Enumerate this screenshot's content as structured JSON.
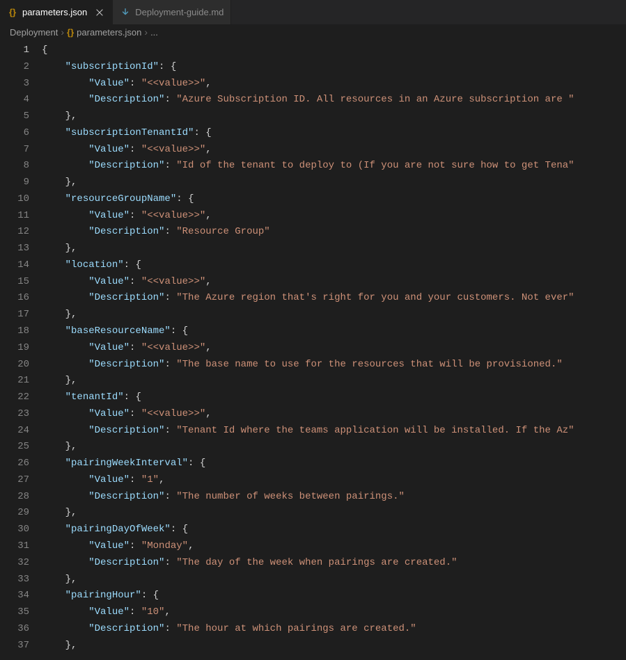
{
  "tabs": {
    "active": {
      "label": "parameters.json"
    },
    "inactive": {
      "label": "Deployment-guide.md"
    }
  },
  "breadcrumbs": {
    "item0": "Deployment",
    "item1": "parameters.json",
    "item2": "..."
  },
  "code": {
    "open": "{",
    "entries": [
      {
        "key": "subscriptionId",
        "value": "<<value>>",
        "desc": "Azure Subscription ID. All resources in an Azure subscription are "
      },
      {
        "key": "subscriptionTenantId",
        "value": "<<value>>",
        "desc": "Id of the tenant to deploy to (If you are not sure how to get Tena"
      },
      {
        "key": "resourceGroupName",
        "value": "<<value>>",
        "desc": "Resource Group"
      },
      {
        "key": "location",
        "value": "<<value>>",
        "desc": "The Azure region that's right for you and your customers. Not ever"
      },
      {
        "key": "baseResourceName",
        "value": "<<value>>",
        "desc": "The base name to use for the resources that will be provisioned."
      },
      {
        "key": "tenantId",
        "value": "<<value>>",
        "desc": "Tenant Id where the teams application will be installed. If the Az"
      },
      {
        "key": "pairingWeekInterval",
        "value": "1",
        "desc": "The number of weeks between pairings."
      },
      {
        "key": "pairingDayOfWeek",
        "value": "Monday",
        "desc": "The day of the week when pairings are created."
      },
      {
        "key": "pairingHour",
        "value": "10",
        "desc": "The hour at which pairings are created."
      }
    ]
  }
}
